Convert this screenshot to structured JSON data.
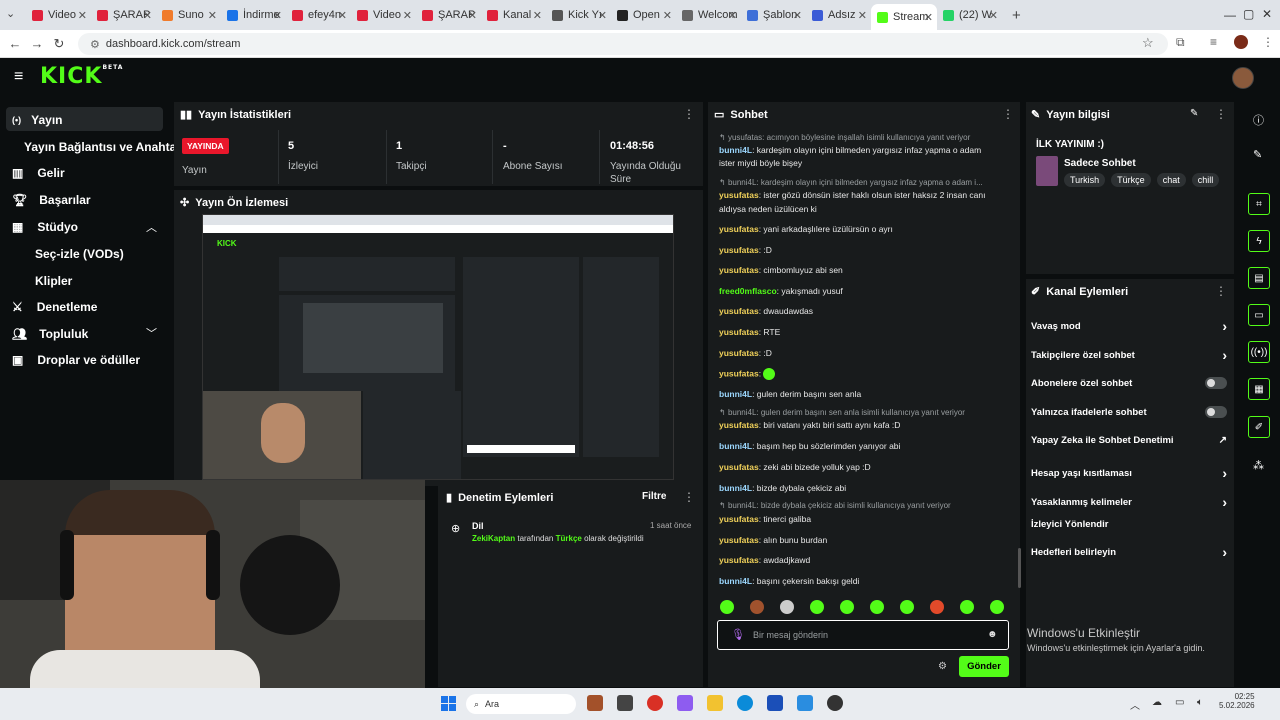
{
  "browser": {
    "tabs": [
      {
        "title": "Video",
        "color": "#e0223c"
      },
      {
        "title": "ŞARAP",
        "color": "#e0223c"
      },
      {
        "title": "Suno",
        "color": "#f07b2b"
      },
      {
        "title": "İndirme",
        "color": "#1a73e8"
      },
      {
        "title": "efey4n",
        "color": "#e0223c"
      },
      {
        "title": "Video",
        "color": "#e0223c"
      },
      {
        "title": "ŞARAP",
        "color": "#e0223c"
      },
      {
        "title": "Kanal",
        "color": "#e0223c"
      },
      {
        "title": "Kick Yı",
        "color": "#555555"
      },
      {
        "title": "Open",
        "color": "#222222"
      },
      {
        "title": "Welcom",
        "color": "#666666"
      },
      {
        "title": "Şablon",
        "color": "#3e6fd8"
      },
      {
        "title": "Adsız",
        "color": "#3b5bd6"
      },
      {
        "title": "Stream",
        "color": "#53fc18"
      },
      {
        "title": "(22) W",
        "color": "#25d366"
      }
    ],
    "url": "dashboard.kick.com/stream"
  },
  "brand": {
    "logo": "KICK",
    "beta": "BETA",
    "accent": "#53fc18"
  },
  "sidebar": {
    "items": [
      {
        "label": "Yayın"
      },
      {
        "label": "Yayın Bağlantısı ve Anahtarı"
      },
      {
        "label": "Gelir"
      },
      {
        "label": "Başarılar"
      },
      {
        "label": "Stüdyo"
      },
      {
        "label": "Seç-izle (VODs)"
      },
      {
        "label": "Klipler"
      },
      {
        "label": "Denetleme"
      },
      {
        "label": "Topluluk"
      },
      {
        "label": "Droplar ve ödüller"
      }
    ]
  },
  "stats": {
    "title": "Yayın İstatistikleri",
    "live_badge": "YAYINDA",
    "cells": [
      {
        "value": "",
        "label": "Yayın"
      },
      {
        "value": "5",
        "label": "İzleyici"
      },
      {
        "value": "1",
        "label": "Takipçi"
      },
      {
        "value": "-",
        "label": "Abone Sayısı"
      },
      {
        "value": "01:48:56",
        "label": "Yayında Olduğu Süre"
      }
    ]
  },
  "preview": {
    "title": "Yayın Ön İzlemesi"
  },
  "moderation": {
    "title": "Denetim Eylemleri",
    "filter": "Filtre",
    "entry_title": "Dil",
    "entry_time": "1 saat önce",
    "entry_user": "ZekiKaptan",
    "entry_mid": " tarafından ",
    "entry_lang": "Türkçe",
    "entry_end": " olarak değiştirildi"
  },
  "chat": {
    "title": "Sohbet",
    "messages": [
      {
        "kind": "reply",
        "text": "yusufatas: acımıyon böylesine inşallah isimli kullanıcıya yanıt veriyor"
      },
      {
        "kind": "msg",
        "user": "bunni4L",
        "color": "#9cd8ff",
        "text": ": kardeşim olayın içini bilmeden yargısız infaz yapma o adam"
      },
      {
        "kind": "cont",
        "text": "ister miydi böyle bişey"
      },
      {
        "kind": "reply",
        "text": "bunni4L: kardeşim olayın içini bilmeden yargısız infaz yapma o adam i..."
      },
      {
        "kind": "msg",
        "user": "yusufatas",
        "color": "#f0d15a",
        "text": ": ister gözü dönsün ister haklı olsun ister haksız 2 insan canı"
      },
      {
        "kind": "cont",
        "text": "aldıysa neden üzülücen ki"
      },
      {
        "kind": "msg",
        "user": "yusufatas",
        "color": "#f0d15a",
        "text": ": yani arkadaşlılere üzülürsün o ayrı"
      },
      {
        "kind": "msg",
        "user": "yusufatas",
        "color": "#f0d15a",
        "text": ": :D"
      },
      {
        "kind": "msg",
        "user": "yusufatas",
        "color": "#f0d15a",
        "text": ": cimbomluyuz abi sen"
      },
      {
        "kind": "msg",
        "user": "freed0mflasco",
        "color": "#53fc18",
        "text": ": yakışmadı yusuf"
      },
      {
        "kind": "msg",
        "user": "yusufatas",
        "color": "#f0d15a",
        "text": ": dwaudawdas"
      },
      {
        "kind": "msg",
        "user": "yusufatas",
        "color": "#f0d15a",
        "text": ": RTE"
      },
      {
        "kind": "msg",
        "user": "yusufatas",
        "color": "#f0d15a",
        "text": ": :D"
      },
      {
        "kind": "msg",
        "user": "yusufatas",
        "color": "#f0d15a",
        "text": ": "
      },
      {
        "kind": "msg",
        "user": "bunni4L",
        "color": "#9cd8ff",
        "text": ": gulen derim başını sen anla"
      },
      {
        "kind": "reply",
        "text": "bunni4L: gulen derim başını sen anla isimli kullanıcıya yanıt veriyor"
      },
      {
        "kind": "msg",
        "user": "yusufatas",
        "color": "#f0d15a",
        "text": ": biri vatanı yaktı biri sattı aynı kafa :D"
      },
      {
        "kind": "msg",
        "user": "bunni4L",
        "color": "#9cd8ff",
        "text": ": başım hep bu sözlerimden yanıyor abi"
      },
      {
        "kind": "msg",
        "user": "yusufatas",
        "color": "#f0d15a",
        "text": ": zeki abi bizede yolluk yap :D"
      },
      {
        "kind": "msg",
        "user": "bunni4L",
        "color": "#9cd8ff",
        "text": ": bizde dybala çekiciz abi"
      },
      {
        "kind": "reply",
        "text": "bunni4L: bizde dybala çekiciz abi isimli kullanıcıya yanıt veriyor"
      },
      {
        "kind": "msg",
        "user": "yusufatas",
        "color": "#f0d15a",
        "text": ": tinerci galiba"
      },
      {
        "kind": "msg",
        "user": "yusufatas",
        "color": "#f0d15a",
        "text": ": alın bunu burdan"
      },
      {
        "kind": "msg",
        "user": "yusufatas",
        "color": "#f0d15a",
        "text": ": awdadjkawd"
      },
      {
        "kind": "msg",
        "user": "bunni4L",
        "color": "#9cd8ff",
        "text": ": başını çekersin bakışı geldi"
      }
    ],
    "input_placeholder": "Bir mesaj gönderin",
    "send_label": "Gönder"
  },
  "stream_info": {
    "title": "Yayın bilgisi",
    "stream_title": "İLK YAYINIM :)",
    "category": "Sadece Sohbet",
    "tags": [
      "Turkish",
      "Türkçe",
      "chat",
      "chill"
    ]
  },
  "channel_actions": {
    "title": "Kanal Eylemleri",
    "items": [
      {
        "label": "Vavaş mod",
        "control": "chevron"
      },
      {
        "label": "Takipçilere özel sohbet",
        "control": "chevron"
      },
      {
        "label": "Abonelere özel sohbet",
        "control": "toggle"
      },
      {
        "label": "Yalnızca ifadelerle sohbet",
        "control": "toggle"
      },
      {
        "label": "Yapay Zeka ile Sohbet Denetimi",
        "control": "external"
      },
      {
        "label": "Hesap yaşı kısıtlaması",
        "control": "chevron"
      },
      {
        "label": "Yasaklanmış kelimeler",
        "control": "chevron"
      },
      {
        "label": "İzleyici Yönlendir",
        "control": "none"
      },
      {
        "label": "Hedefleri belirleyin",
        "control": "chevron"
      }
    ]
  },
  "windows": {
    "activate_title": "Windows'u Etkinleştir",
    "activate_sub": "Windows'u etkinleştirmek için Ayarlar'a gidin.",
    "search": "Ara",
    "time": "02:25",
    "date": "5.02.2026"
  }
}
